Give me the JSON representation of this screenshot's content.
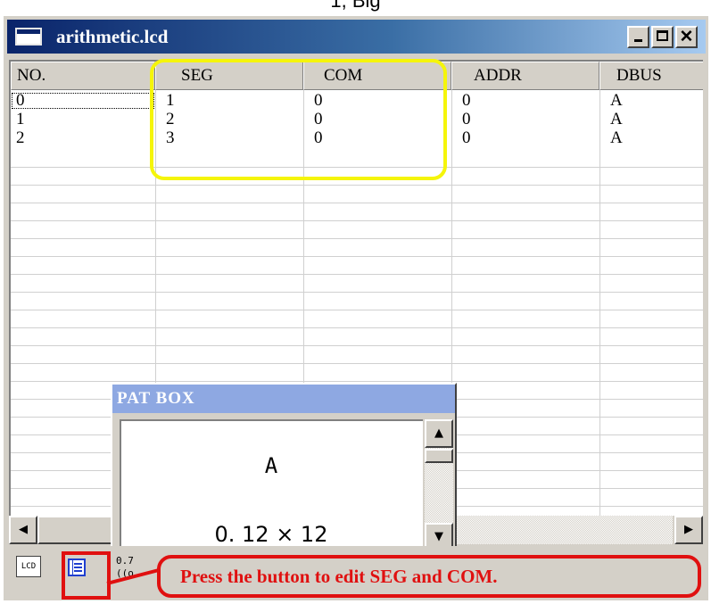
{
  "top_caption": "1, Big",
  "window": {
    "title": "arithmetic.lcd"
  },
  "table": {
    "columns": [
      "NO.",
      "SEG",
      "COM",
      "ADDR",
      "DBUS"
    ],
    "rows": [
      [
        "0",
        "1",
        "0",
        "0",
        "A"
      ],
      [
        "1",
        "2",
        "0",
        "0",
        "A"
      ],
      [
        "2",
        "3",
        "0",
        "0",
        "A"
      ]
    ]
  },
  "pat_box": {
    "title": "PAT BOX",
    "glyph": "A",
    "size": "0. 12 × 12"
  },
  "toolbar": {
    "lcd_label": "LCD",
    "sound_label": "0.7 ((o"
  },
  "callout": "Press the button to edit SEG and COM.",
  "colors": {
    "highlight": "#f5f50a",
    "annotation": "#e01010",
    "titlebar": "#0a246a"
  },
  "icons": {
    "minimize": "minimize-icon",
    "maximize": "maximize-icon",
    "close": "close-icon",
    "scroll_left": "arrow-left-icon",
    "scroll_right": "arrow-right-icon",
    "scroll_up": "arrow-up-icon",
    "scroll_down": "arrow-down-icon",
    "table_edit": "table-icon",
    "lcd": "lcd-icon",
    "sound": "sound-icon"
  }
}
